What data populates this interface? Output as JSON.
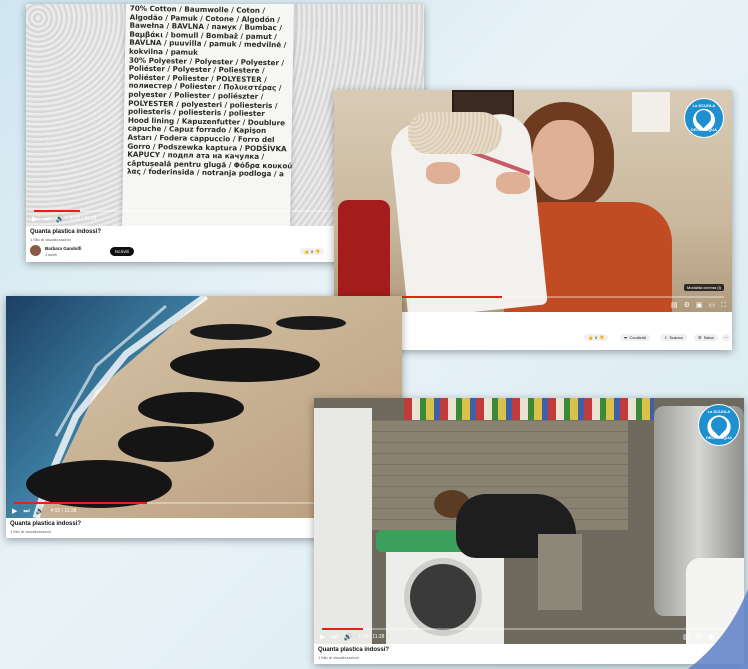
{
  "video1": {
    "label_lines": [
      "70% Cotton / Baumwolle / Coton /",
      "Algodão / Pamuk / Cotone / Algodón /",
      "Bawełna / BAVLNA / памук / Bumbac /",
      "Βαμβάκι / bomull / Bombaž / pamut /",
      "BAVLNA / puuvilla / pamuk / medvilnė /",
      "kokvilna / pamuk",
      "30% Polyester / Polyester / Polyester /",
      "Poliéster / Polyester / Poliestere /",
      "Poliéster / Poliester / POLYESTER /",
      "полиестер / Poliester / Πολυεστέρας /",
      "polyester / Poliester / poliészter /",
      "POLYESTER / polyesteri / poliesteris /",
      "poliesteris / poliesteris / poliester",
      "",
      "Hood lining / Kapuzenfutter / Doublure",
      "capuche / Capuz forrado / Kapişon",
      "Astarı / Fodera cappuccio / Forro del",
      "Gorro / Podszewka kaptura / PODŠÍVKA",
      "KAPUCY / подпл ата на качулка /",
      "căptușeală pentru glugă / Φόδρα κουκού",
      "λας / foderinsida / notranja podloga / a"
    ],
    "time": "1:12 / 11:28",
    "title": "Quanta plastica indossi?",
    "views": "1 Mio di visualizzazioni",
    "channel": "Barbara Gandolfi",
    "subs": "4 iscritti",
    "subscribe": "Iscriviti",
    "likes": "0",
    "progress": 0.12
  },
  "video2": {
    "logo_top": "La SCUOLA",
    "logo_bottom": "DELL'ACQUA",
    "badge": "Modalità cinema (t)",
    "likes": "0",
    "share": "Condividi",
    "remix": "Scarica",
    "save": "Salva",
    "progress": 0.42
  },
  "video3": {
    "time": "4:02 / 11:28",
    "title": "Quanta plastica indossi?",
    "views": "1 Mio di visualizzazioni",
    "progress": 0.35
  },
  "video4": {
    "logo_top": "La SCUOLA",
    "logo_bottom": "DELL'ACQUA",
    "time": "1:15 / 11:28",
    "title": "Quanta plastica indossi?",
    "views": "1 Mio di visualizzazioni",
    "progress": 0.1
  },
  "colors": {
    "accent": "#e62117",
    "brand": "#1e8fcf",
    "background": "#dcecf3"
  }
}
